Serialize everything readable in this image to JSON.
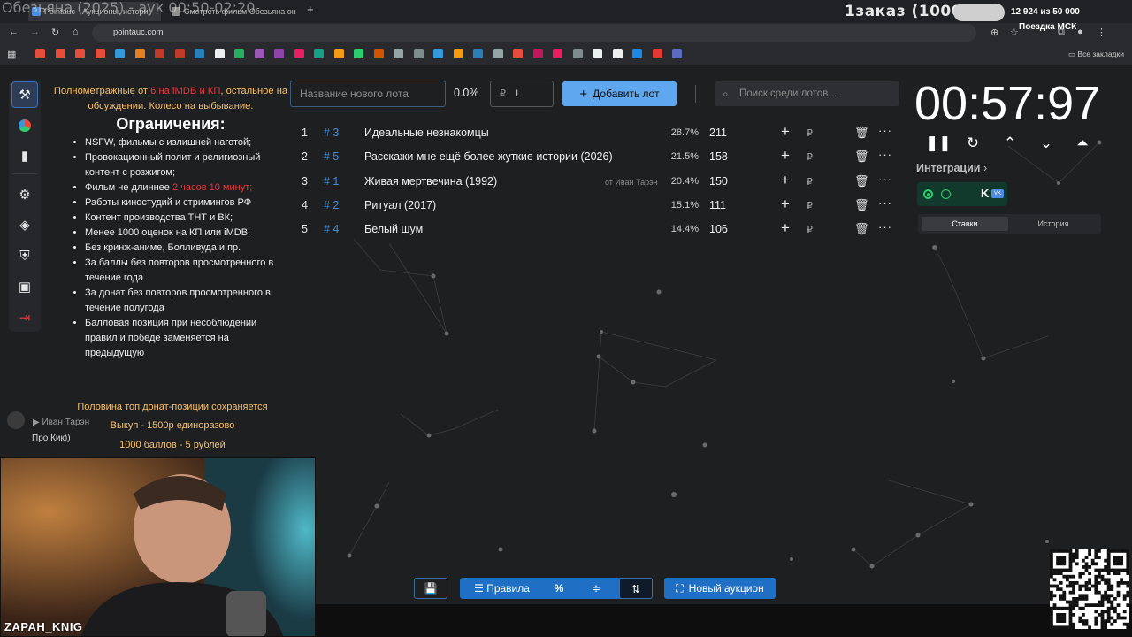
{
  "browser": {
    "overlay_title": "Обезьяна (2025) - аук 00:50-02:20",
    "tabs": [
      {
        "label": "Pointauc - Аукционы, истори"
      },
      {
        "label": "Смотреть фильм Обезьяна он"
      }
    ],
    "url": "pointauc.com",
    "bookmarks_label": "Все закладки"
  },
  "stream_overlay": {
    "order_text": "1заказ (1000р)",
    "progress_text": "12 924  из 50 000",
    "trip_text": "Поездка МСК"
  },
  "rules": {
    "note_part1": "Полнометражные от ",
    "note_red": "6 на iMDB и КП",
    "note_part2": ", остальное на обсуждении. Колесо на выбывание.",
    "heading": "Ограничения:",
    "items": [
      "NSFW, фильмы с излишней наготой;",
      "Провокационный полит и религиозный контент с розжигом;",
      "Фильм не длиннее ",
      "Работы киностудий и стримингов РФ",
      "Контент производства ТНТ и ВК;",
      "Менее 1000 оценок на КП или iMDB;",
      "Без кринж-аниме, Болливуда и пр.",
      "За баллы без повторов просмотренного в течение года",
      "За донат без повторов просмотренного в течение полугода",
      "Балловая позиция при несоблюдении правил и победе заменяется на предыдущую"
    ],
    "item3_red": "2 часов 10 минут;",
    "line1": "Половина топ донат-позиции сохраняется",
    "line2": "Выкуп - 1500р единоразово",
    "line3": "1000 баллов - 5 рублей"
  },
  "chat": {
    "user": "Иван Тарэн",
    "message": "Про Кик))"
  },
  "webcam": {
    "name": "ZAPAH_KNIG"
  },
  "controls": {
    "lot_placeholder": "Название нового лота",
    "percent": "0.0%",
    "amount_symbol": "₽",
    "add_button": "Добавить лот",
    "search_placeholder": "Поиск среди лотов..."
  },
  "lots": [
    {
      "num": "1",
      "id": "# 3",
      "name": "Идеальные незнакомцы",
      "from": "",
      "pct": "28.7%",
      "amount": "211"
    },
    {
      "num": "2",
      "id": "# 5",
      "name": "Расскажи мне ещё более жуткие истории (2026)",
      "from": "",
      "pct": "21.5%",
      "amount": "158"
    },
    {
      "num": "3",
      "id": "# 1",
      "name": "Живая мертвечина (1992)",
      "from": "от Иван Тарэн",
      "pct": "20.4%",
      "amount": "150"
    },
    {
      "num": "4",
      "id": "# 2",
      "name": "Ритуал (2017)",
      "from": "",
      "pct": "15.1%",
      "amount": "111"
    },
    {
      "num": "5",
      "id": "# 4",
      "name": "Белый шум",
      "from": "",
      "pct": "14.4%",
      "amount": "106"
    }
  ],
  "lot_actions": {
    "plus": "+",
    "rub": "₽",
    "delete": "🗑",
    "more": "···"
  },
  "timer": {
    "value": "00:57:97",
    "integrations_label": "Интеграции",
    "tab_bets": "Ставки",
    "tab_history": "История"
  },
  "toolbar": {
    "save": "💾",
    "rules": "Правила",
    "percent": "%",
    "equal": "≑",
    "sort": "⇅",
    "new_auction": "Новый аукцион"
  },
  "colors": {
    "accent": "#5fa8ef",
    "toolbar_blue": "#1f6fc4",
    "id_blue": "#3f8fe0",
    "gold": "#f5c06c",
    "red": "#e0393e"
  }
}
